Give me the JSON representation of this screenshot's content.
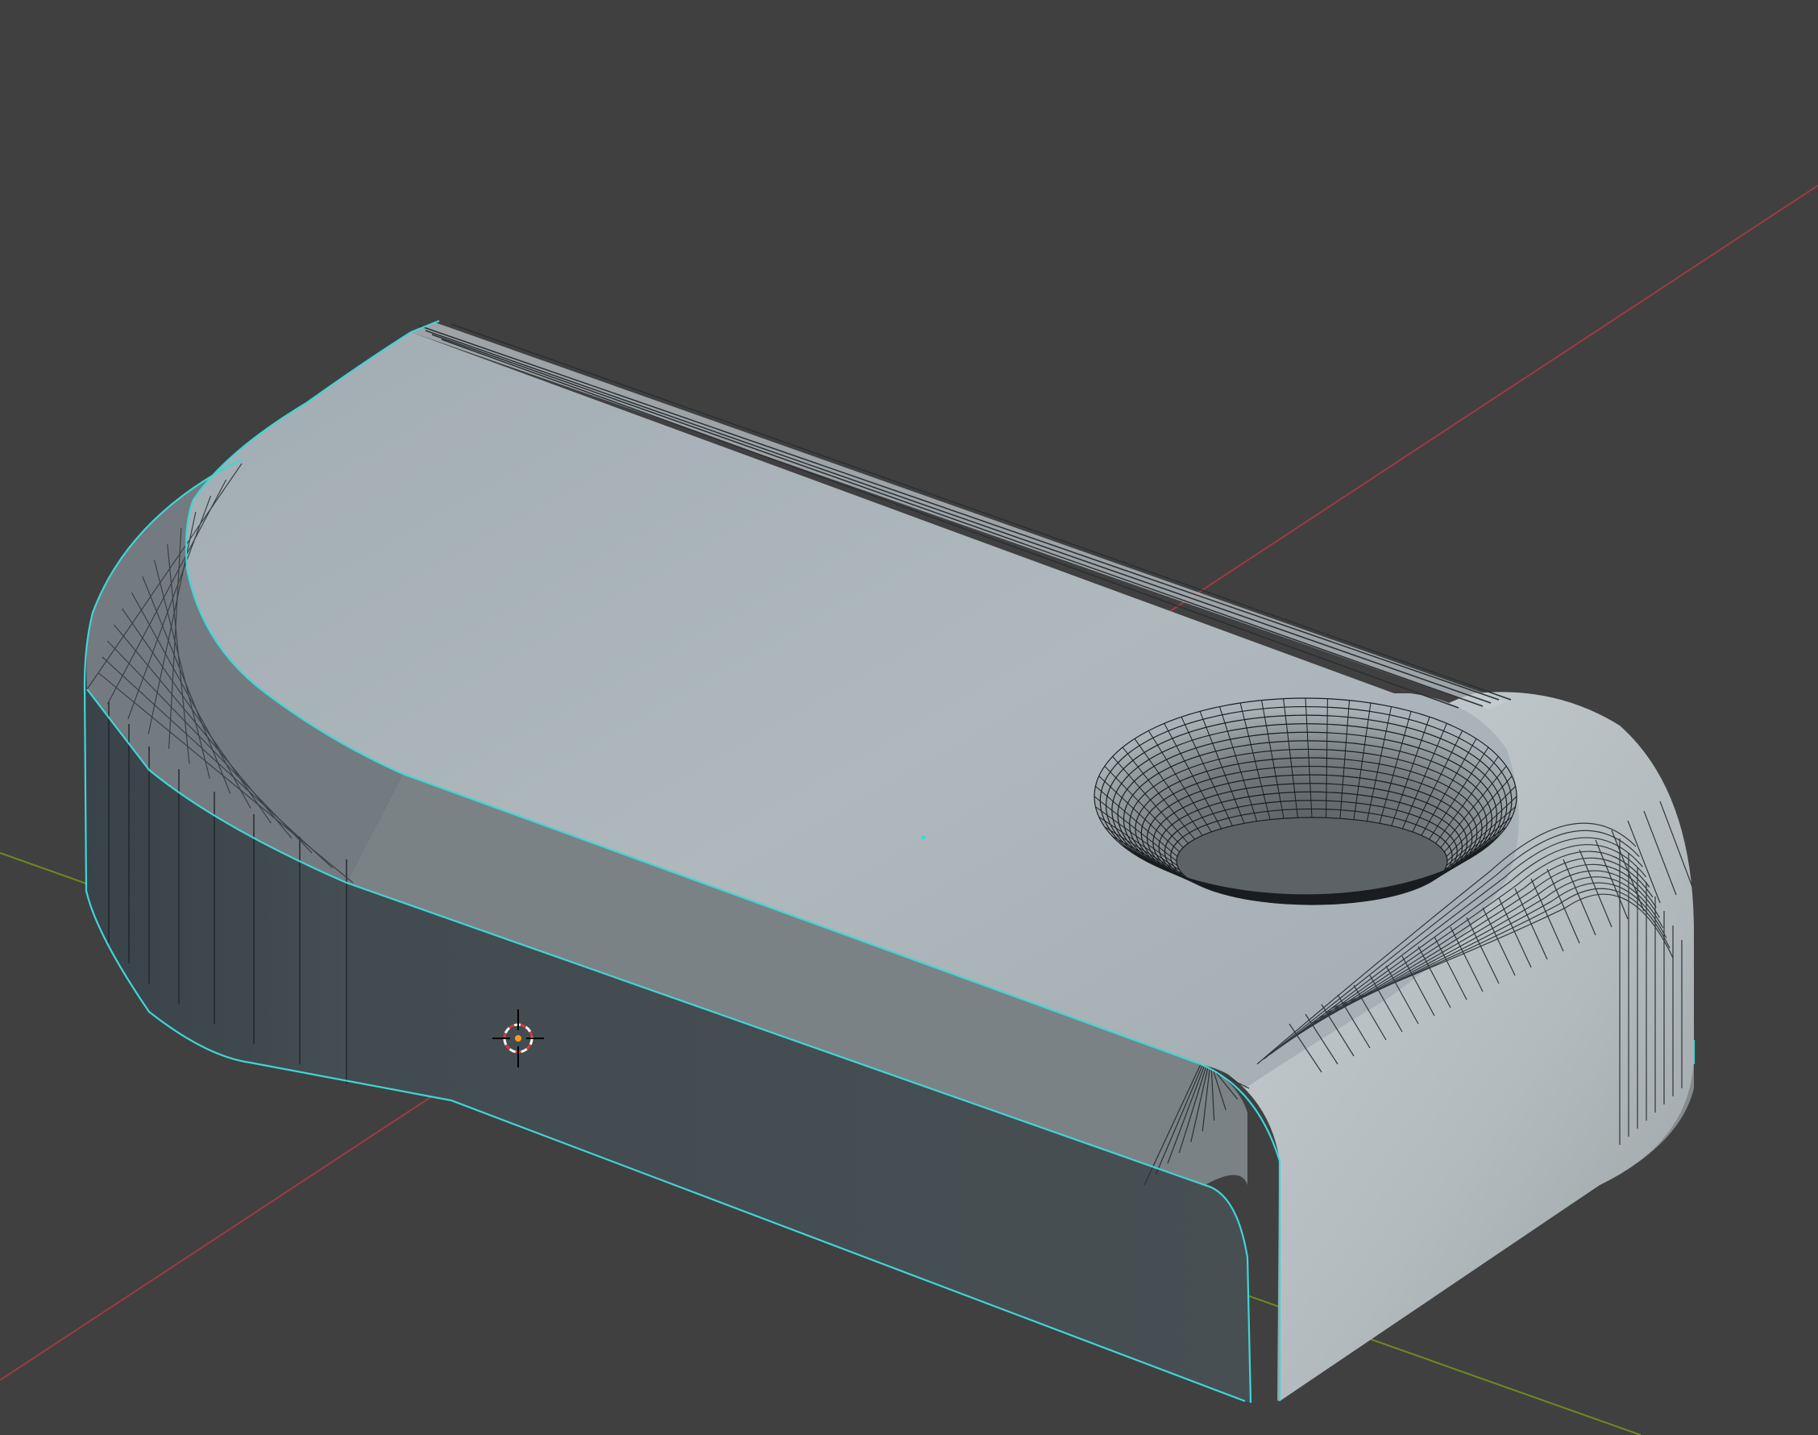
{
  "viewport": {
    "background": "#404040",
    "axis_x_color": "#9e3a45",
    "axis_y_color": "#6f8a1e",
    "selection_outline_color": "#3fd6d6",
    "wire_color": "#1a1d20"
  },
  "scene": {
    "object": "mesh-object",
    "mode": "edit-mode-wireframe-overlay",
    "gizmo": "3d-cursor-icon",
    "origin": "object-origin-dot"
  },
  "colors": {
    "top": "#a9b3b8",
    "top_edge": "#c4cdd1",
    "front": "#434b50",
    "front_bevel": "#7b8285",
    "left_round": "#3c464c",
    "left_bevel": "#737b80",
    "right_side": "#8c9091",
    "right_round_top": "#bfc6c9",
    "hole_inner": "#6e7477",
    "cursor_orange": "#ff9a1f"
  }
}
